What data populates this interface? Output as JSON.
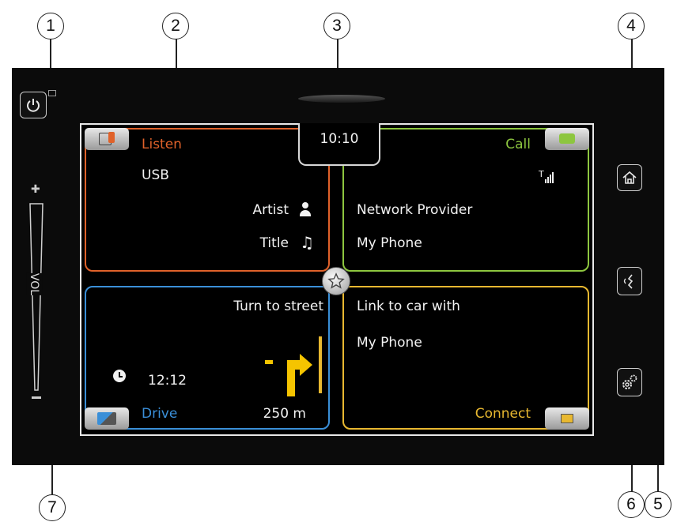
{
  "callouts": [
    "1",
    "2",
    "3",
    "4",
    "5",
    "6",
    "7"
  ],
  "clock": "10:10",
  "tiles": {
    "listen": {
      "title": "Listen",
      "source": "USB",
      "artist": "Artist",
      "track": "Title",
      "color": "#e0622a"
    },
    "call": {
      "title": "Call",
      "provider": "Network Provider",
      "phone": "My Phone",
      "color": "#8dc63f"
    },
    "drive": {
      "title": "Drive",
      "instruction": "Turn to street",
      "eta": "12:12",
      "distance": "250 m",
      "color": "#3a8fd8"
    },
    "connect": {
      "title": "Connect",
      "line1": "Link to car with",
      "line2": "My Phone",
      "color": "#e8b830"
    }
  },
  "volume_label": "VOL",
  "icons": [
    "power-icon",
    "home-icon",
    "voice-icon",
    "settings-icon",
    "star-icon",
    "person-icon",
    "music-note-icon",
    "signal-icon",
    "clock-icon",
    "turn-right-arrow-icon"
  ]
}
